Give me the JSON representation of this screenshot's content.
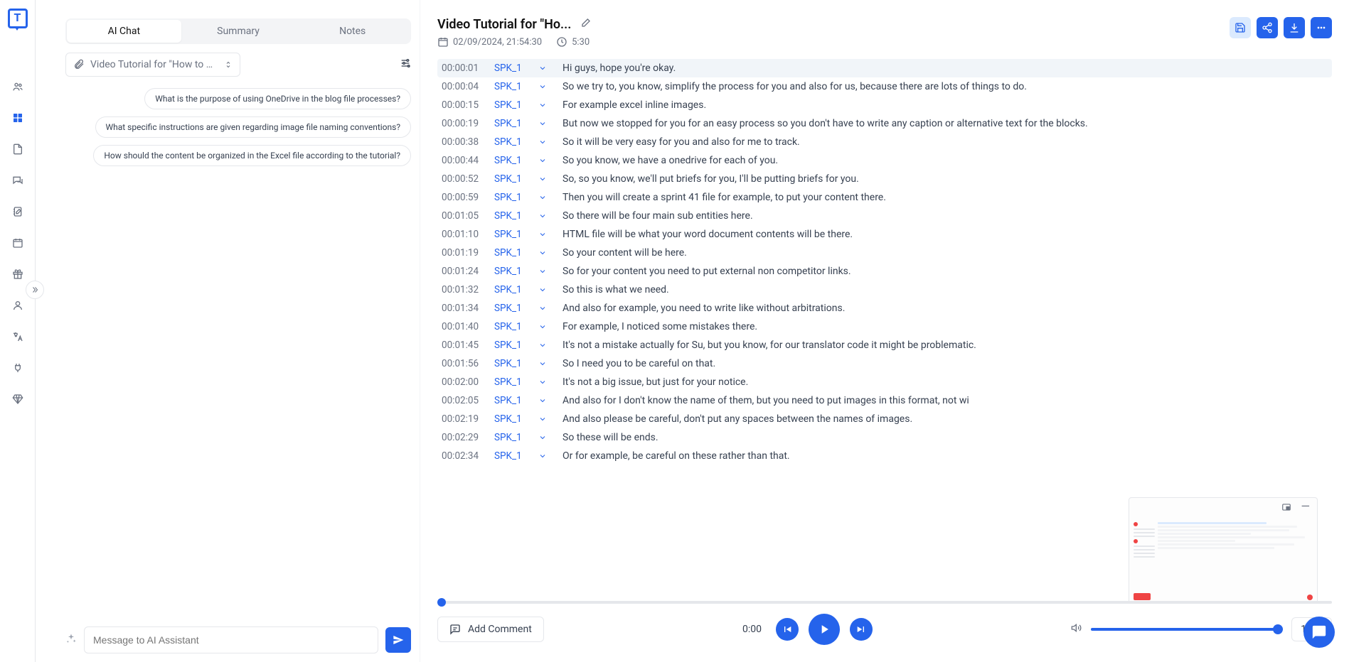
{
  "sidebar": {
    "items": [
      {
        "name": "people-icon"
      },
      {
        "name": "dashboard-icon"
      },
      {
        "name": "document-icon"
      },
      {
        "name": "chat-icon"
      },
      {
        "name": "edit-icon"
      },
      {
        "name": "calendar-icon"
      },
      {
        "name": "gift-icon"
      },
      {
        "name": "user-icon"
      },
      {
        "name": "translate-icon"
      },
      {
        "name": "plug-icon"
      },
      {
        "name": "diamond-icon"
      }
    ]
  },
  "tabs": [
    {
      "label": "AI Chat",
      "active": true
    },
    {
      "label": "Summary",
      "active": false
    },
    {
      "label": "Notes",
      "active": false
    }
  ],
  "file_chip": "Video Tutorial for \"How to Us...",
  "suggestions": [
    "What is the purpose of using OneDrive in the blog file processes?",
    "What specific instructions are given regarding image file naming conventions?",
    "How should the content be organized in the Excel file according to the tutorial?"
  ],
  "chat_placeholder": "Message to AI Assistant",
  "header": {
    "title": "Video Tutorial for \"Ho...",
    "date": "02/09/2024, 21:54:30",
    "duration": "5:30"
  },
  "transcript": [
    {
      "ts": "00:00:01",
      "spk": "SPK_1",
      "text": "Hi guys, hope you're okay.",
      "hl": true
    },
    {
      "ts": "00:00:04",
      "spk": "SPK_1",
      "text": "So we try to, you know, simplify the process for you and also for us, because there are lots of things to do."
    },
    {
      "ts": "00:00:15",
      "spk": "SPK_1",
      "text": "For example excel inline images."
    },
    {
      "ts": "00:00:19",
      "spk": "SPK_1",
      "text": "But now we stopped for you for an easy process so you don't have to write any caption or alternative text for the blocks."
    },
    {
      "ts": "00:00:38",
      "spk": "SPK_1",
      "text": "So it will be very easy for you and also for me to track."
    },
    {
      "ts": "00:00:44",
      "spk": "SPK_1",
      "text": "So you know, we have a onedrive for each of you."
    },
    {
      "ts": "00:00:52",
      "spk": "SPK_1",
      "text": "So, so you know, we'll put briefs for you, I'll be putting briefs for you."
    },
    {
      "ts": "00:00:59",
      "spk": "SPK_1",
      "text": "Then you will create a sprint 41 file for example, to put your content there."
    },
    {
      "ts": "00:01:05",
      "spk": "SPK_1",
      "text": "So there will be four main sub entities here."
    },
    {
      "ts": "00:01:10",
      "spk": "SPK_1",
      "text": "HTML file will be what your word document contents will be there."
    },
    {
      "ts": "00:01:19",
      "spk": "SPK_1",
      "text": "So your content will be here."
    },
    {
      "ts": "00:01:24",
      "spk": "SPK_1",
      "text": "So for your content you need to put external non competitor links."
    },
    {
      "ts": "00:01:32",
      "spk": "SPK_1",
      "text": "So this is what we need."
    },
    {
      "ts": "00:01:34",
      "spk": "SPK_1",
      "text": "And also for example, you need to write like without arbitrations."
    },
    {
      "ts": "00:01:40",
      "spk": "SPK_1",
      "text": "For example, I noticed some mistakes there."
    },
    {
      "ts": "00:01:45",
      "spk": "SPK_1",
      "text": "It's not a mistake actually for Su, but you know, for our translator code it might be problematic."
    },
    {
      "ts": "00:01:56",
      "spk": "SPK_1",
      "text": "So I need you to be careful on that."
    },
    {
      "ts": "00:02:00",
      "spk": "SPK_1",
      "text": "It's not a big issue, but just for your notice."
    },
    {
      "ts": "00:02:05",
      "spk": "SPK_1",
      "text": "And also for I don't know the name of them, but you need to put images in this format, not wi"
    },
    {
      "ts": "00:02:19",
      "spk": "SPK_1",
      "text": "And also please be careful, don't put any spaces between the names of images."
    },
    {
      "ts": "00:02:29",
      "spk": "SPK_1",
      "text": "So these will be ends."
    },
    {
      "ts": "00:02:34",
      "spk": "SPK_1",
      "text": "Or for example, be careful on these rather than that."
    }
  ],
  "player": {
    "comment_label": "Add Comment",
    "time": "0:00",
    "speed": "1x"
  }
}
